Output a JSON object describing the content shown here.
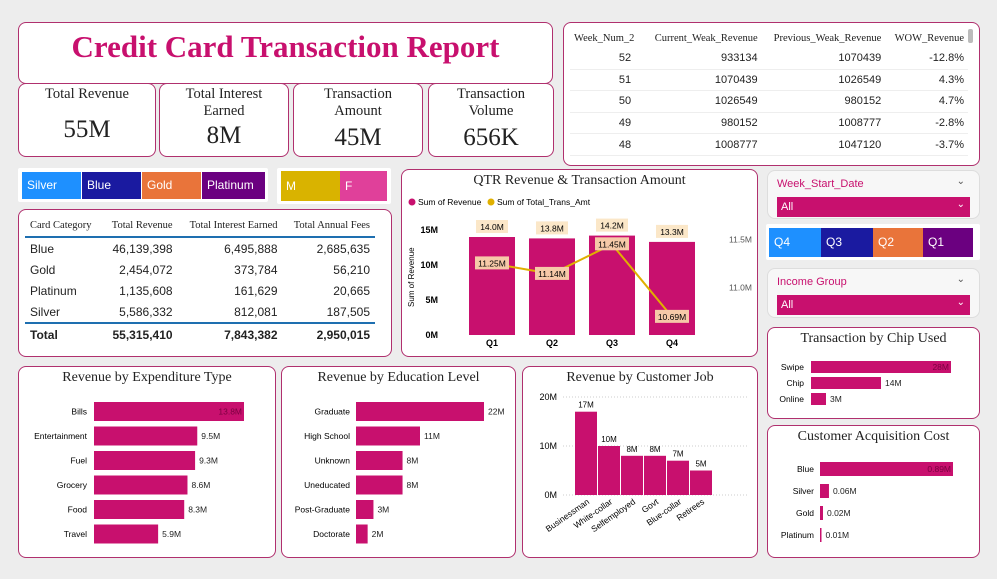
{
  "report_title": "Credit Card Transaction Report",
  "kpis": [
    {
      "label": "Total Revenue",
      "value": "55M"
    },
    {
      "label": "Total Interest Earned",
      "value": "8M"
    },
    {
      "label": "Transaction Amount",
      "value": "45M"
    },
    {
      "label": "Transaction Volume",
      "value": "656K"
    }
  ],
  "card_slicer": [
    {
      "label": "Silver",
      "color": "#1e90ff"
    },
    {
      "label": "Blue",
      "color": "#1a1aa0"
    },
    {
      "label": "Gold",
      "color": "#e9743a"
    },
    {
      "label": "Platinum",
      "color": "#6b0080"
    }
  ],
  "gender_slicer": [
    {
      "label": "M",
      "color": "#d9b300"
    },
    {
      "label": "F",
      "color": "#e0409a"
    }
  ],
  "card_table": {
    "headers": [
      "Card Category",
      "Total Revenue",
      "Total Interest Earned",
      "Total Annual Fees"
    ],
    "rows": [
      [
        "Blue",
        "46,139,398",
        "6,495,888",
        "2,685,635"
      ],
      [
        "Gold",
        "2,454,072",
        "373,784",
        "56,210"
      ],
      [
        "Platinum",
        "1,135,608",
        "161,629",
        "20,665"
      ],
      [
        "Silver",
        "5,586,332",
        "812,081",
        "187,505"
      ]
    ],
    "total": [
      "Total",
      "55,315,410",
      "7,843,382",
      "2,950,015"
    ]
  },
  "week_table": {
    "headers": [
      "Week_Num_2",
      "Current_Weak_Revenue",
      "Previous_Weak_Revenue",
      "WOW_Revenue"
    ],
    "rows": [
      [
        "52",
        "933134",
        "1070439",
        "-12.8%"
      ],
      [
        "51",
        "1070439",
        "1026549",
        "4.3%"
      ],
      [
        "50",
        "1026549",
        "980152",
        "4.7%"
      ],
      [
        "49",
        "980152",
        "1008777",
        "-2.8%"
      ],
      [
        "48",
        "1008777",
        "1047120",
        "-3.7%"
      ]
    ]
  },
  "week_start_filter": {
    "label": "Week_Start_Date",
    "value": "All"
  },
  "income_filter": {
    "label": "Income Group",
    "value": "All"
  },
  "qtr_slicer": [
    {
      "label": "Q4",
      "color": "#1e90ff"
    },
    {
      "label": "Q3",
      "color": "#1a1aa0"
    },
    {
      "label": "Q2",
      "color": "#e9743a"
    },
    {
      "label": "Q1",
      "color": "#6b0080"
    }
  ],
  "colors": {
    "accent": "#c8106e",
    "line": "#e0b000",
    "border": "#b0306e"
  },
  "chart_data": [
    {
      "id": "qtr",
      "type": "bar",
      "title": "QTR Revenue & Transaction Amount",
      "legend": [
        "Sum of Revenue",
        "Sum of Total_Trans_Amt"
      ],
      "legend_position": "top-left",
      "ylabel": "Sum of Revenue",
      "categories": [
        "Q1",
        "Q2",
        "Q3",
        "Q4"
      ],
      "ylim": [
        0,
        15
      ],
      "y_ticks": [
        "15M",
        "10M",
        "5M",
        "0M"
      ],
      "y2_ticks": [
        "11.5M",
        "11.0M"
      ],
      "y2lim": [
        10.5,
        11.6
      ],
      "series": [
        {
          "name": "Sum of Revenue",
          "type": "bar",
          "values": [
            14.0,
            13.8,
            14.2,
            13.3
          ],
          "labels": [
            "14.0M",
            "13.8M",
            "14.2M",
            "13.3M"
          ]
        },
        {
          "name": "Sum of Total_Trans_Amt",
          "type": "line",
          "values": [
            11.25,
            11.14,
            11.45,
            10.69
          ],
          "labels": [
            "11.25M",
            "11.14M",
            "11.45M",
            "10.69M"
          ]
        }
      ]
    },
    {
      "id": "chip",
      "type": "bar",
      "orientation": "horizontal",
      "title": "Transaction by Chip Used",
      "categories": [
        "Swipe",
        "Chip",
        "Online"
      ],
      "values": [
        28,
        14,
        3
      ],
      "labels": [
        "28M",
        "14M",
        "3M"
      ]
    },
    {
      "id": "expenditure",
      "type": "bar",
      "orientation": "horizontal",
      "title": "Revenue by Expenditure Type",
      "categories": [
        "Bills",
        "Entertainment",
        "Fuel",
        "Grocery",
        "Food",
        "Travel"
      ],
      "values": [
        13.8,
        9.5,
        9.3,
        8.6,
        8.3,
        5.9
      ],
      "labels": [
        "13.8M",
        "9.5M",
        "9.3M",
        "8.6M",
        "8.3M",
        "5.9M"
      ]
    },
    {
      "id": "education",
      "type": "bar",
      "orientation": "horizontal",
      "title": "Revenue by Education Level",
      "categories": [
        "Graduate",
        "High School",
        "Unknown",
        "Uneducated",
        "Post-Graduate",
        "Doctorate"
      ],
      "values": [
        22,
        11,
        8,
        8,
        3,
        2
      ],
      "labels": [
        "22M",
        "11M",
        "8M",
        "8M",
        "3M",
        "2M"
      ]
    },
    {
      "id": "job",
      "type": "bar",
      "title": "Revenue by Customer Job",
      "categories": [
        "Businessman",
        "White-collar",
        "Selfemployed",
        "Govt",
        "Blue-collar",
        "Retirees"
      ],
      "values": [
        17,
        10,
        8,
        8,
        7,
        5
      ],
      "labels": [
        "17M",
        "10M",
        "8M",
        "8M",
        "7M",
        "5M"
      ],
      "ylim": [
        0,
        20
      ],
      "y_ticks": [
        "20M",
        "10M",
        "0M"
      ]
    },
    {
      "id": "cac",
      "type": "bar",
      "orientation": "horizontal",
      "title": "Customer Acquisition Cost",
      "categories": [
        "Blue",
        "Silver",
        "Gold",
        "Platinum"
      ],
      "values": [
        0.89,
        0.06,
        0.02,
        0.01
      ],
      "labels": [
        "0.89M",
        "0.06M",
        "0.02M",
        "0.01M"
      ]
    }
  ]
}
